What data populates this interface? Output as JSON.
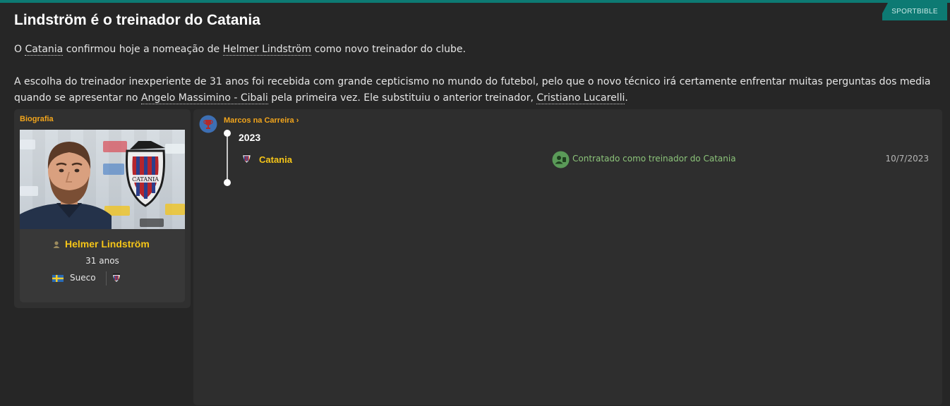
{
  "source": {
    "label": "SPORTBIBLE"
  },
  "article": {
    "headline": "Lindström é o treinador do Catania",
    "p1": {
      "t1": "O ",
      "club": "Catania",
      "t2": " confirmou hoje a nomeação de ",
      "person": "Helmer Lindström",
      "t3": " como novo treinador do clube."
    },
    "p2": {
      "t1": "A escolha do treinador inexperiente de 31 anos foi recebida com grande cepticismo no mundo do futebol, pelo que o novo técnico irá certamente enfrentar muitas perguntas dos media quando se apresentar no ",
      "stadium": "Angelo Massimino - Cibali",
      "t2": " pela primeira vez. Ele substituiu o anterior treinador, ",
      "previous": "Cristiano Lucarelli",
      "t3": "."
    }
  },
  "biography": {
    "title": "Biografia",
    "name": "Helmer Lindström",
    "age": "31 anos",
    "nationality": "Sueco",
    "flag_icon": "sweden-flag-icon",
    "club_icon": "catania-crest-icon",
    "crest_text": "CATANIA"
  },
  "milestones": {
    "title": "Marcos na Carreira",
    "chevron": "›",
    "year": "2023",
    "event": {
      "club": "Catania",
      "description": "Contratado como treinador do Catania",
      "date": "10/7/2023",
      "icon": "manager-signed-icon"
    }
  },
  "colors": {
    "accent": "#0d7a73",
    "highlight": "#f5c518",
    "section_title": "#f2a51c",
    "success": "#8cc47a"
  }
}
